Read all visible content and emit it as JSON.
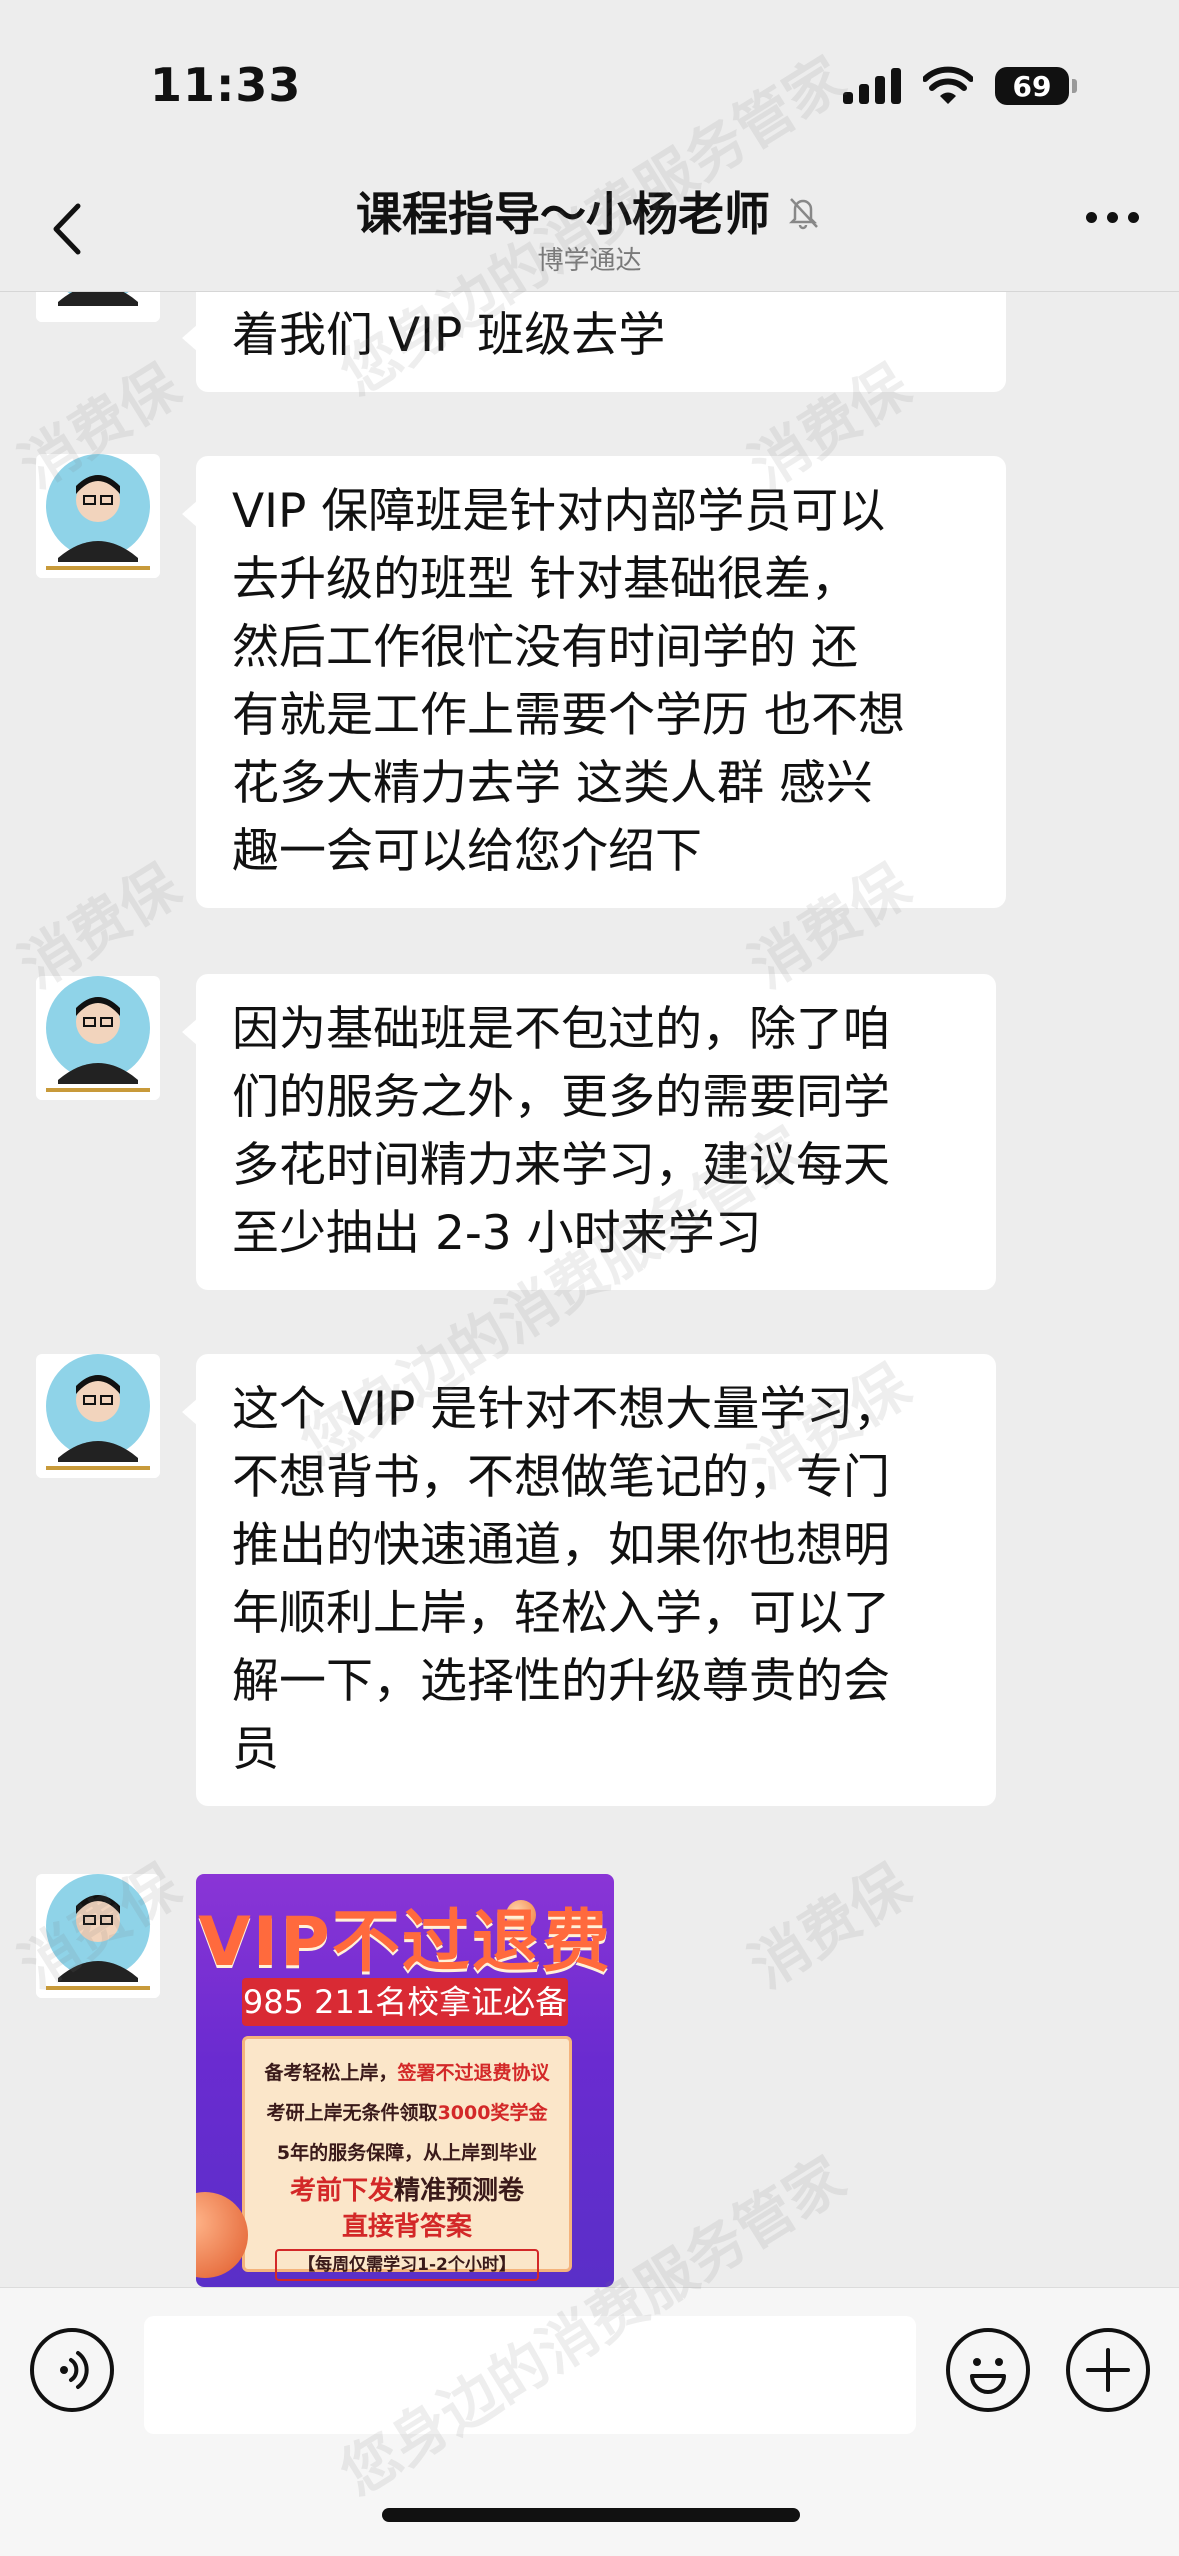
{
  "status_bar": {
    "time": "11:33",
    "battery": "69",
    "icons": [
      "signal-icon",
      "wifi-icon",
      "battery-icon"
    ]
  },
  "nav": {
    "title": "课程指导～小杨老师",
    "subtitle": "博学通达",
    "icons": [
      "back-icon",
      "mute-icon",
      "more-icon"
    ]
  },
  "messages": [
    {
      "sender": "other",
      "text": "着我们 VIP 班级去学"
    },
    {
      "sender": "other",
      "text": "VIP 保障班是针对内部学员可以\n去升级的班型  针对基础很差，\n然后工作很忙没有时间学的  还\n有就是工作上需要个学历 也不想\n花多大精力去学 这类人群   感兴\n趣一会可以给您介绍下"
    },
    {
      "sender": "other",
      "text": "因为基础班是不包过的，除了咱\n们的服务之外，更多的需要同学\n多花时间精力来学习，建议每天\n至少抽出 2-3 小时来学习"
    },
    {
      "sender": "other",
      "text": "这个 VIP 是针对不想大量学习，\n不想背书，不想做笔记的，专门\n推出的快速通道，如果你也想明\n年顺利上岸，轻松入学，可以了\n解一下，选择性的升级尊贵的会\n员"
    }
  ],
  "promo_image": {
    "title": "VIP不过退费",
    "banner": "985 211名校拿证必备",
    "line1_a": "备考轻松上岸，",
    "line1_b": "签署不过退费协议",
    "line2_a": "考研上岸无条件领取",
    "line2_b": "3000奖学金",
    "line3": "5年的服务保障，从上岸到毕业",
    "line4_a": "考前下发",
    "line4_b": "精准预测卷",
    "line5": "直接背答案",
    "line6": "【每周仅需学习1-2个小时】"
  },
  "input_bar": {
    "placeholder": "",
    "icons": [
      "voice-icon",
      "emoji-icon",
      "plus-icon"
    ]
  },
  "watermarks": [
    "消费保",
    "您身边的消费服务管家"
  ],
  "colors": {
    "background": "#ededed",
    "bubble": "#ffffff",
    "promo_purple": "#6a2bd0",
    "promo_red": "#d92a34"
  }
}
